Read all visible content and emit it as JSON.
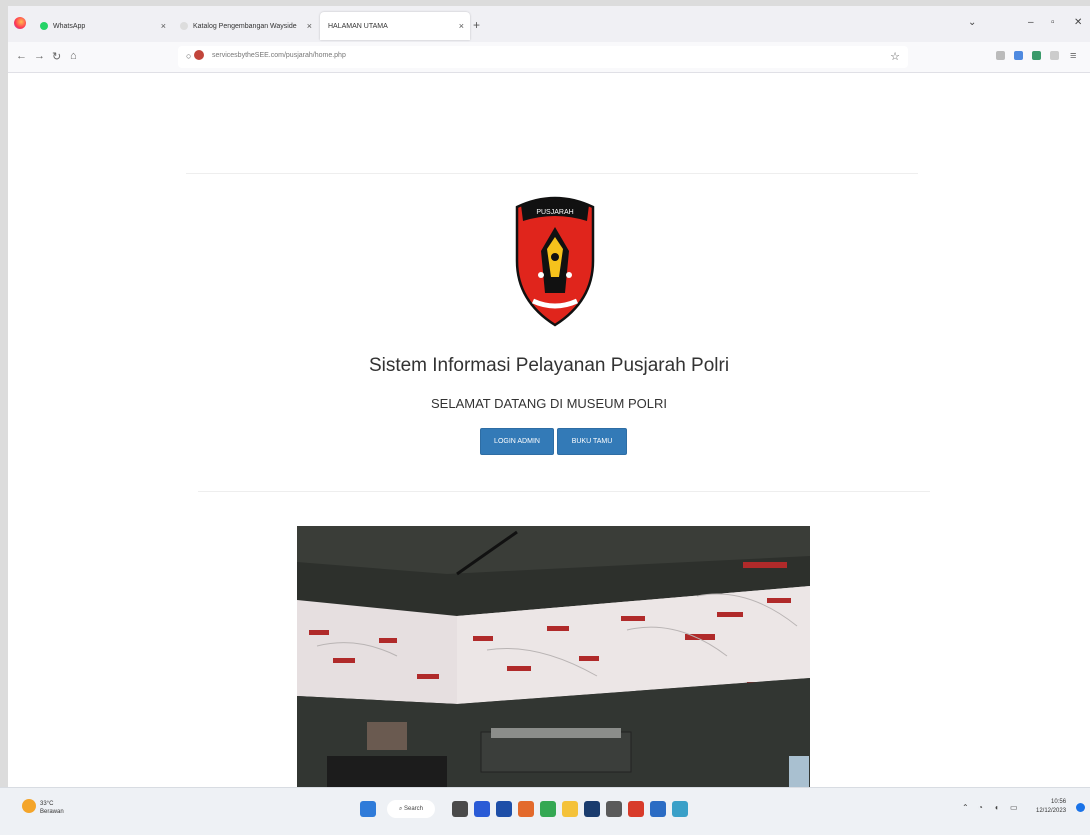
{
  "browser": {
    "tabs": [
      {
        "label": "WhatsApp",
        "active": false
      },
      {
        "label": "Katalog Pengembangan Wayside",
        "active": false
      },
      {
        "label": "HALAMAN UTAMA",
        "active": true
      }
    ],
    "url": "servicesbytheSEE.com/pusjarah/home.php"
  },
  "page": {
    "title": "Sistem Informasi Pelayanan Pusjarah Polri",
    "subtitle": "SELAMAT DATANG DI MUSEUM POLRI",
    "login_button": "LOGIN ADMIN",
    "guestbook_button": "BUKU TAMU",
    "logo_banner": "PUSJARAH"
  },
  "taskbar": {
    "weather_temp": "33°C",
    "weather_desc": "Berawan",
    "search_label": "Search",
    "time": "10:56",
    "date": "12/12/2023"
  },
  "colors": {
    "primary_button": "#337ab7",
    "logo_red": "#e0251c"
  }
}
